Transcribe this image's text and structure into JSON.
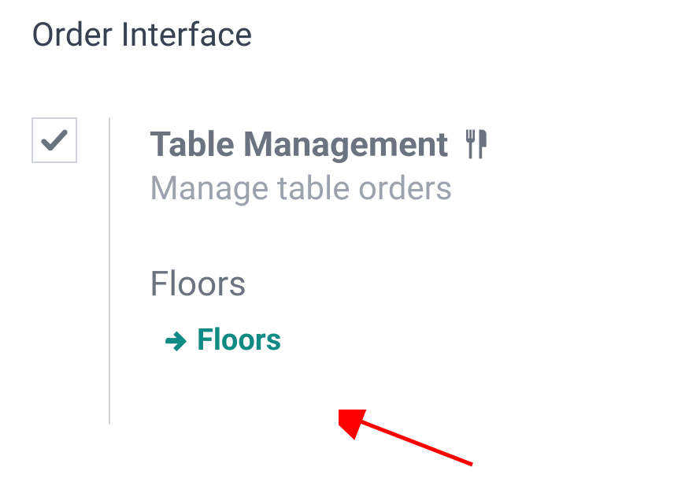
{
  "section": {
    "title": "Order Interface"
  },
  "setting": {
    "checked": true,
    "label": "Table Management",
    "description": "Manage table orders",
    "sub_label": "Floors",
    "link_text": "Floors"
  },
  "colors": {
    "accent": "#0f8a84",
    "text_primary": "#374151",
    "text_muted": "#6b7280",
    "text_light": "#9ca3af",
    "annotation": "#ff0000"
  }
}
